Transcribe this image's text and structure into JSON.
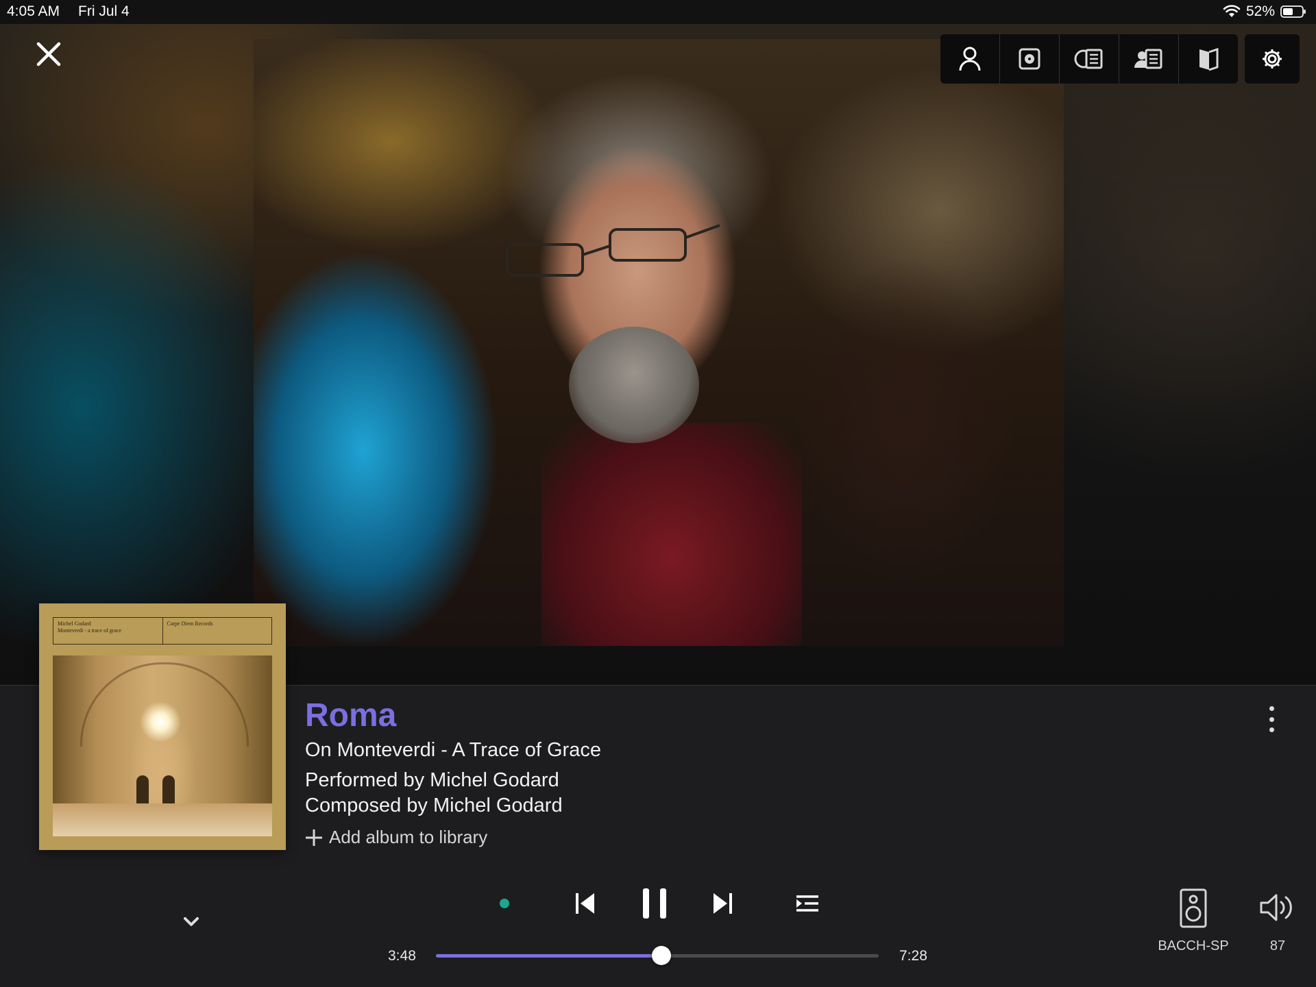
{
  "status_bar": {
    "time": "4:05 AM",
    "date": "Fri Jul 4",
    "battery_percent": "52%",
    "battery_level": 0.52
  },
  "toolbar": {
    "icons": [
      "close-icon",
      "artist-icon",
      "album-icon",
      "album-notes-icon",
      "artist-notes-icon",
      "booklet-icon",
      "gear-icon"
    ]
  },
  "album_art": {
    "header_left": "Michel Godard\nMonteverdi - a trace of grace",
    "header_right": "Carpe Diem Records"
  },
  "track": {
    "title": "Roma",
    "album": "On Monteverdi - A Trace of Grace",
    "performer": "Performed by Michel Godard",
    "composer": "Composed by Michel Godard",
    "add_to_library": "Add album to library"
  },
  "playback": {
    "elapsed": "3:48",
    "total": "7:28",
    "progress_fraction": 0.5089,
    "status_color": "#1aa88c"
  },
  "output": {
    "zone_name": "BACCH-SP",
    "volume": "87"
  },
  "colors": {
    "accent": "#7b6fe0",
    "panel_bg": "#1d1d1f"
  }
}
